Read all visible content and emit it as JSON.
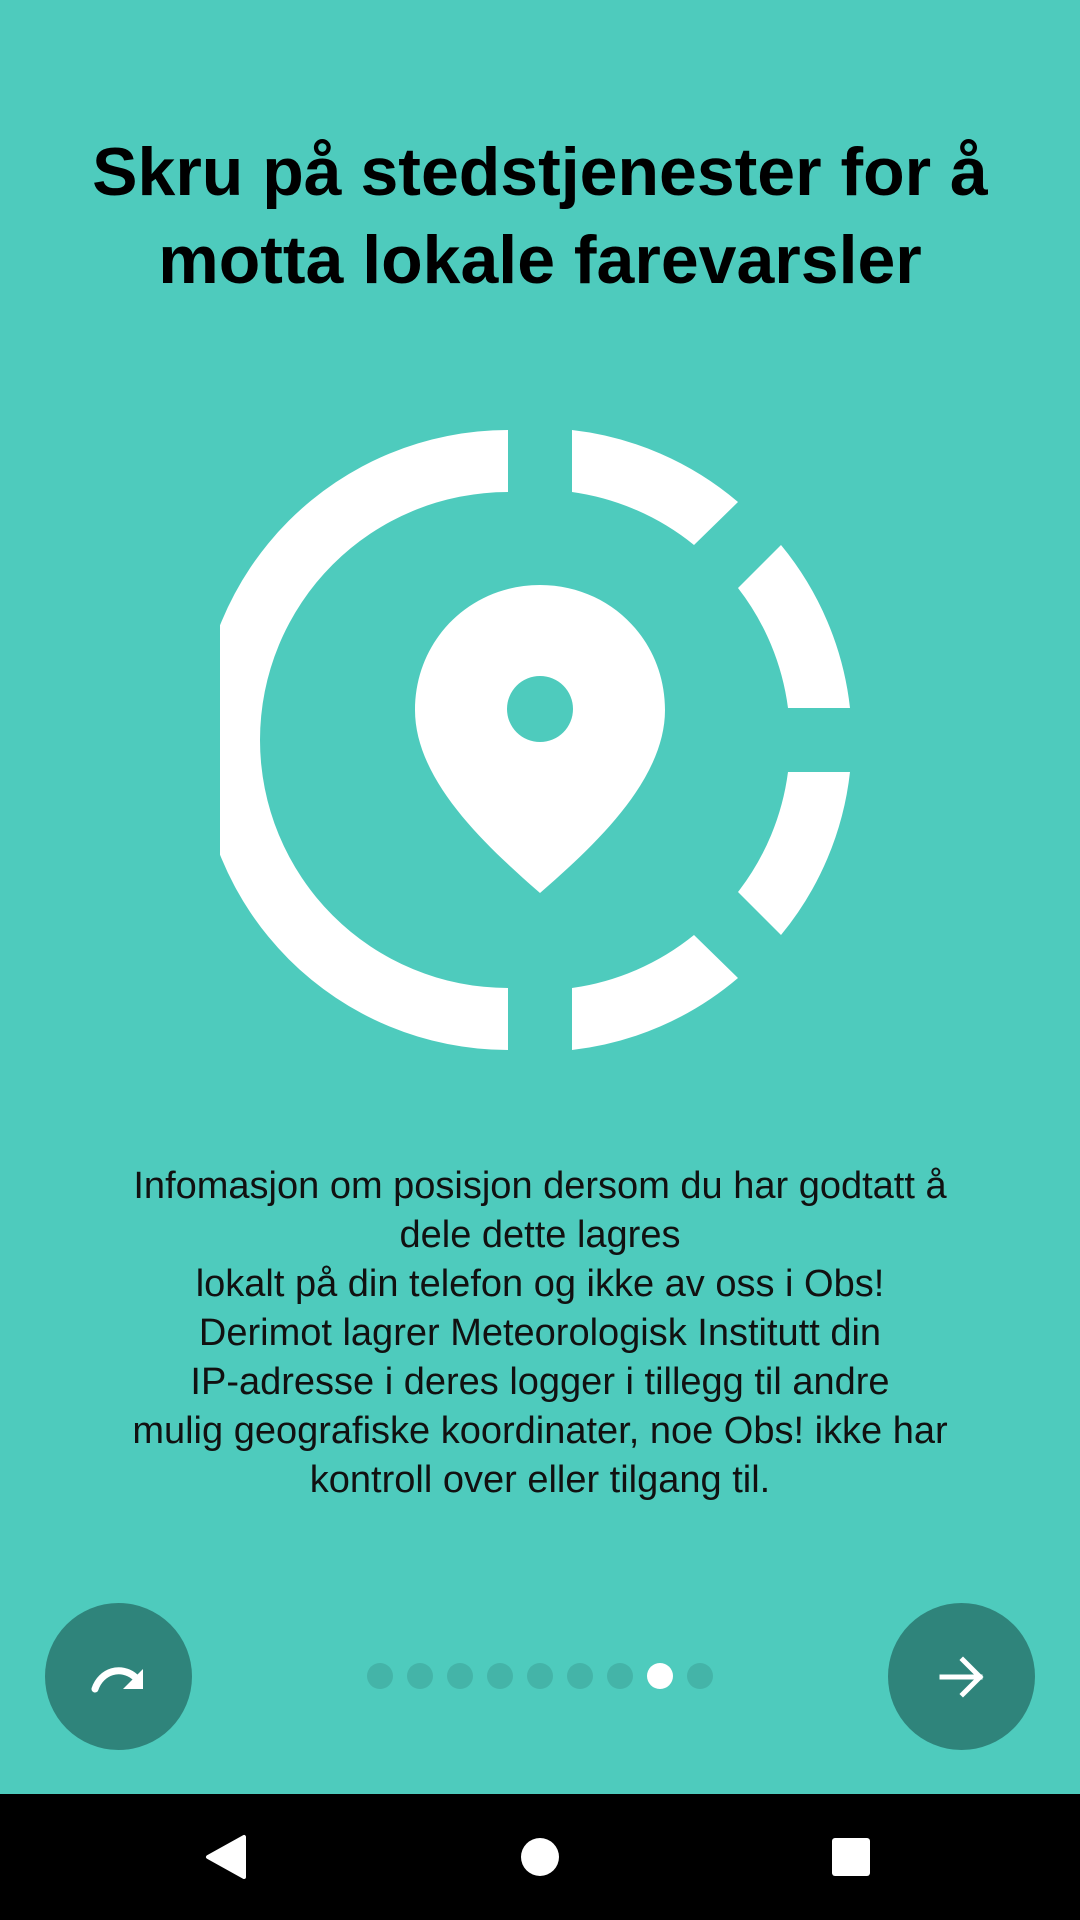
{
  "onboarding": {
    "title": "Skru på stedstjenester for å motta lokale farevarsler",
    "description": "Infomasjon om posisjon dersom du har godtatt å\ndele dette lagres\n        lokalt på din telefon og ikke av oss i Obs!\n        Derimot lagrer Meteorologisk Institutt din\n        IP-adresse i deres logger i tillegg til andre\n        mulig geografiske koordinater, noe Obs! ikke har\n        kontroll over eller tilgang til.",
    "illustration_icon": "location-target-icon",
    "skip_icon": "skip-arrow-icon",
    "next_icon": "arrow-right-icon",
    "page_indicator": {
      "total": 9,
      "current": 8
    }
  },
  "navbar": {
    "back_icon": "back-triangle-icon",
    "home_icon": "home-circle-icon",
    "recents_icon": "recents-square-icon"
  },
  "colors": {
    "background": "#4ecbbd",
    "button": "#2f847b",
    "dot_inactive": "#44b4a8",
    "dot_active": "#ffffff"
  }
}
